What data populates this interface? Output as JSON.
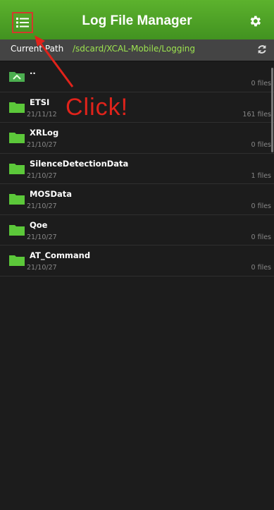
{
  "app": {
    "title": "Log File Manager"
  },
  "header": {
    "menu_icon": "list-menu-icon",
    "settings_icon": "gear-icon"
  },
  "path": {
    "label": "Current Path",
    "value": "/sdcard/XCAL-Mobile/Logging",
    "refresh_icon": "refresh-icon"
  },
  "files": [
    {
      "name": "..",
      "date": "",
      "count": "0 files",
      "icon": "folder-up-icon"
    },
    {
      "name": "ETSI",
      "date": "21/11/12",
      "count": "161 files",
      "icon": "folder-icon"
    },
    {
      "name": "XRLog",
      "date": "21/10/27",
      "count": "0 files",
      "icon": "folder-icon"
    },
    {
      "name": "SilenceDetectionData",
      "date": "21/10/27",
      "count": "1 files",
      "icon": "folder-icon"
    },
    {
      "name": "MOSData",
      "date": "21/10/27",
      "count": "0 files",
      "icon": "folder-icon"
    },
    {
      "name": "Qoe",
      "date": "21/10/27",
      "count": "0 files",
      "icon": "folder-icon"
    },
    {
      "name": "AT_Command",
      "date": "21/10/27",
      "count": "0 files",
      "icon": "folder-icon"
    }
  ],
  "annotation": {
    "text": "Click!"
  },
  "colors": {
    "appbar": "#4ea326",
    "accent_path": "#9ce34f",
    "annotation": "#e0231b"
  }
}
